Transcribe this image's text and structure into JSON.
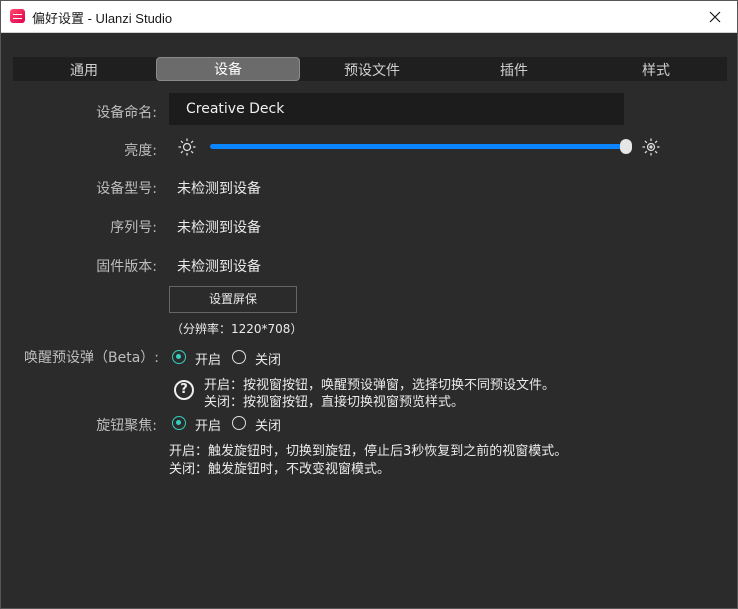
{
  "window": {
    "title": "偏好设置 - Ulanzi Studio"
  },
  "tabs": [
    {
      "label": "通用",
      "active": false
    },
    {
      "label": "设备",
      "active": true
    },
    {
      "label": "预设文件",
      "active": false
    },
    {
      "label": "插件",
      "active": false
    },
    {
      "label": "样式",
      "active": false
    }
  ],
  "device": {
    "name_label": "设备命名:",
    "name_value": "Creative Deck",
    "brightness_label": "亮度:",
    "brightness_value": 1.0,
    "model_label": "设备型号:",
    "model_value": "未检测到设备",
    "serial_label": "序列号:",
    "serial_value": "未检测到设备",
    "firmware_label": "固件版本:",
    "firmware_value": "未检测到设备",
    "screensaver_button": "设置屏保",
    "resolution": "（分辨率：1220*708）"
  },
  "wake_popup": {
    "label": "唤醒预设弹（Beta）:",
    "on_label": "开启",
    "off_label": "关闭",
    "selected": "on",
    "desc_on": "开启：按视窗按钮，唤醒预设弹窗，选择切换不同预设文件。",
    "desc_off": "关闭：按视窗按钮，直接切换视窗预览样式。"
  },
  "knob_focus": {
    "label": "旋钮聚焦:",
    "on_label": "开启",
    "off_label": "关闭",
    "selected": "on",
    "desc_on": "开启：触发旋钮时，切换到旋钮，停止后3秒恢复到之前的视窗模式。",
    "desc_off": "关闭：触发旋钮时，不改变视窗模式。"
  },
  "colors": {
    "accent": "#0a84ff",
    "radio_on": "#35d0c0",
    "background": "#2b2b2b"
  }
}
